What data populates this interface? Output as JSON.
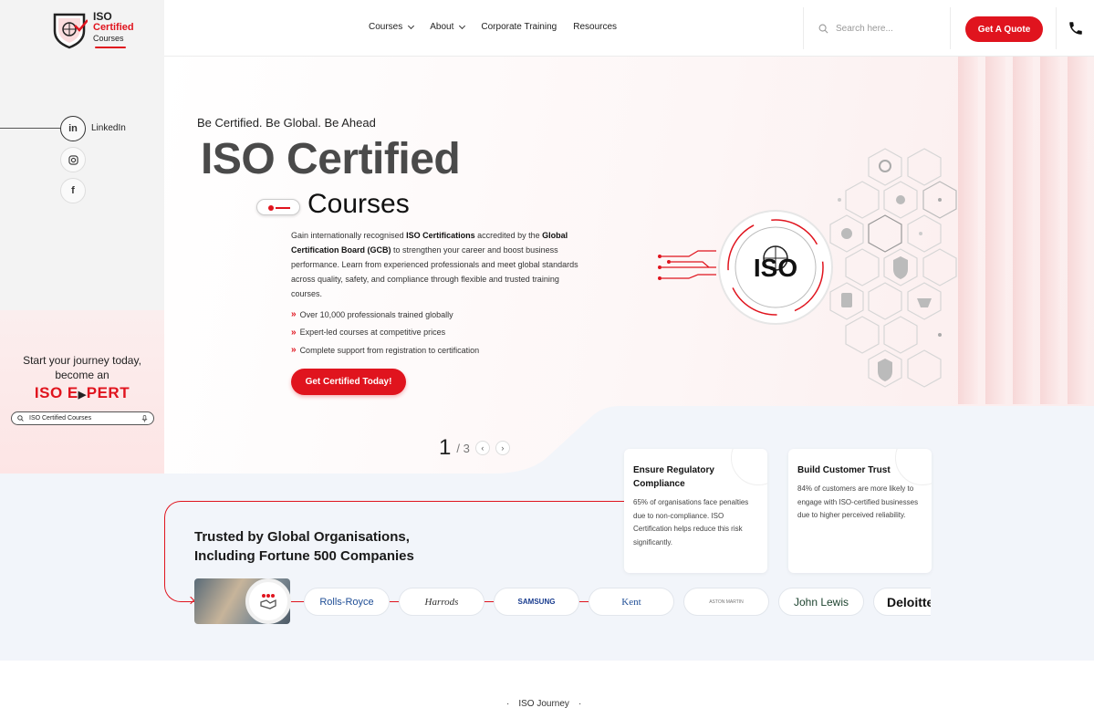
{
  "header": {
    "logo": {
      "line1": "ISO",
      "line2": "Certified",
      "line3": "Courses"
    },
    "nav": [
      {
        "label": "Courses",
        "dropdown": true
      },
      {
        "label": "About",
        "dropdown": true
      },
      {
        "label": "Corporate Training",
        "dropdown": false
      },
      {
        "label": "Resources",
        "dropdown": false
      }
    ],
    "search": {
      "placeholder": "Search here..."
    },
    "quote_button": "Get A Quote",
    "phone_icon": "phone-icon"
  },
  "sidebar": {
    "social": [
      {
        "name": "linkedin-icon",
        "glyph": "in",
        "label": "LinkedIn"
      },
      {
        "name": "instagram-icon",
        "glyph": "◎",
        "label": ""
      },
      {
        "name": "facebook-icon",
        "glyph": "f",
        "label": ""
      }
    ],
    "promo_line1": "Start your journey today,",
    "promo_line2": "become an",
    "promo_expert": "ISO E",
    "promo_expert_tail": "PERT",
    "mini_search_text": "ISO Certified Courses"
  },
  "hero": {
    "tagline": "Be Certified. Be Global. Be Ahead",
    "title": "ISO Certified",
    "subtitle": "Courses",
    "desc_1": "Gain internationally recognised ",
    "desc_b1": "ISO Certifications",
    "desc_2": " accredited by the ",
    "desc_b2": "Global Certification Board (GCB)",
    "desc_3": " to strengthen your career and boost business performance. Learn from experienced professionals and meet global standards across quality, safety, and compliance through flexible and trusted training courses.",
    "bullets": [
      "Over 10,000 professionals trained globally",
      "Expert-led courses at competitive prices",
      "Complete support from registration to certification"
    ],
    "cta": "Get Certified Today!",
    "iso_badge": "ISO",
    "pager": {
      "current": "1",
      "total": "/ 3"
    }
  },
  "stats_cards": [
    {
      "title": "Ensure Regulatory Compliance",
      "text": "65% of organisations face penalties due to non-compliance. ISO Certification helps reduce this risk significantly."
    },
    {
      "title": "Build Customer Trust",
      "text": "84% of customers are more likely to engage with ISO-certified businesses due to higher perceived reliability."
    }
  ],
  "trusted": {
    "line1": "Trusted by Global Organisations,",
    "line2": "Including Fortune 500 Companies",
    "logos": [
      "Rolls-Royce",
      "Harrods",
      "SAMSUNG",
      "Kent",
      "ASTON MARTIN",
      "John Lewis",
      "Deloitte"
    ]
  },
  "footer_peek": {
    "label": "ISO Journey"
  },
  "colors": {
    "accent": "#e0141e",
    "band": "#f2f5fa",
    "sidebar": "#f3f3f3"
  }
}
